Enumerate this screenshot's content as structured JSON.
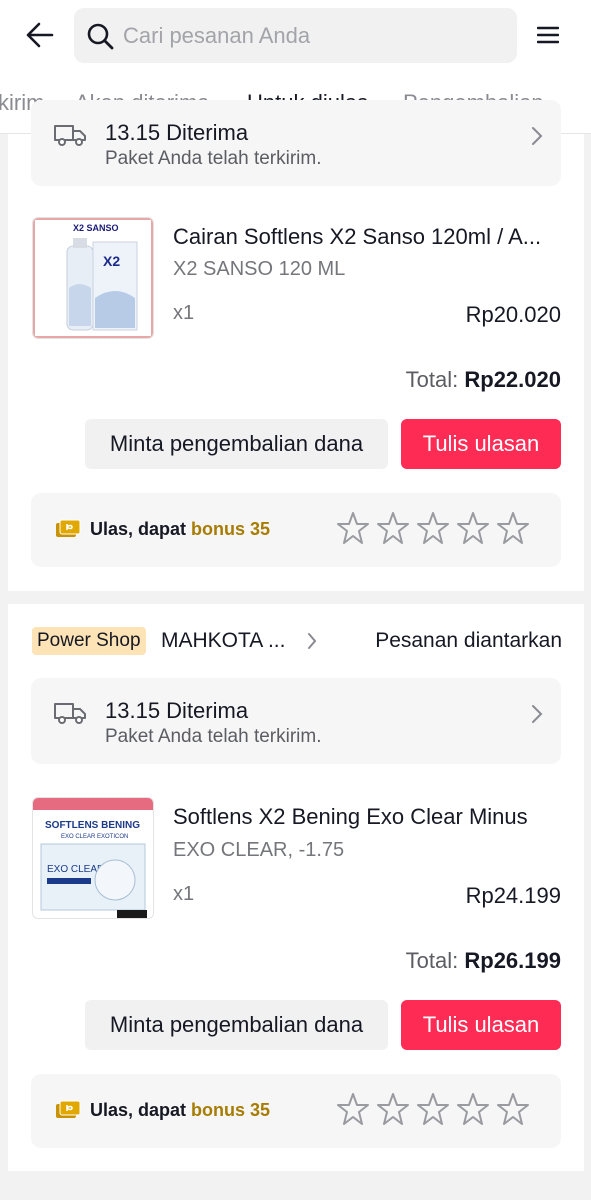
{
  "header": {
    "search_placeholder": "Cari pesanan Anda",
    "back_icon": "arrow-left-icon",
    "menu_icon": "hamburger-menu-icon"
  },
  "tabs": [
    {
      "label": "kirim",
      "active": false
    },
    {
      "label": "Akan diterima",
      "active": false
    },
    {
      "label": "Untuk diulas",
      "active": true
    },
    {
      "label": "Pengembalian",
      "active": false
    }
  ],
  "orders": [
    {
      "delivery": {
        "title": "13.15 Diterima",
        "subtitle": "Paket Anda telah terkirim."
      },
      "product": {
        "name": "Cairan Softlens X2 Sanso 120ml / A...",
        "variant": "X2 SANSO 120 ML",
        "qty": "x1",
        "price": "Rp20.020",
        "thumb_text": "X2 SANSO"
      },
      "total_label": "Total:",
      "total_value": "Rp22.020",
      "refund_label": "Minta pengembalian dana",
      "review_label": "Tulis ulasan",
      "rate_text": "Ulas, dapat",
      "rate_bonus": "bonus 35"
    },
    {
      "shop_badge": "Power Shop",
      "shop_name": "MAHKOTA ...",
      "status": "Pesanan diantarkan",
      "delivery": {
        "title": "13.15 Diterima",
        "subtitle": "Paket Anda telah terkirim."
      },
      "product": {
        "name": "Softlens X2 Bening Exo Clear Minus",
        "variant": "EXO CLEAR, -1.75",
        "qty": "x1",
        "price": "Rp24.199",
        "thumb_text": "SOFTLENS BENING",
        "thumb_subtext": "EXO CLEAR EXOTICON",
        "thumb_brand": "EXO CLEAR"
      },
      "total_label": "Total:",
      "total_value": "Rp26.199",
      "refund_label": "Minta pengembalian dana",
      "review_label": "Tulis ulasan",
      "rate_text": "Ulas, dapat",
      "rate_bonus": "bonus 35"
    }
  ],
  "colors": {
    "accent": "#fe2c55",
    "bonus": "#a77c00",
    "badge": "#fde3b6"
  }
}
